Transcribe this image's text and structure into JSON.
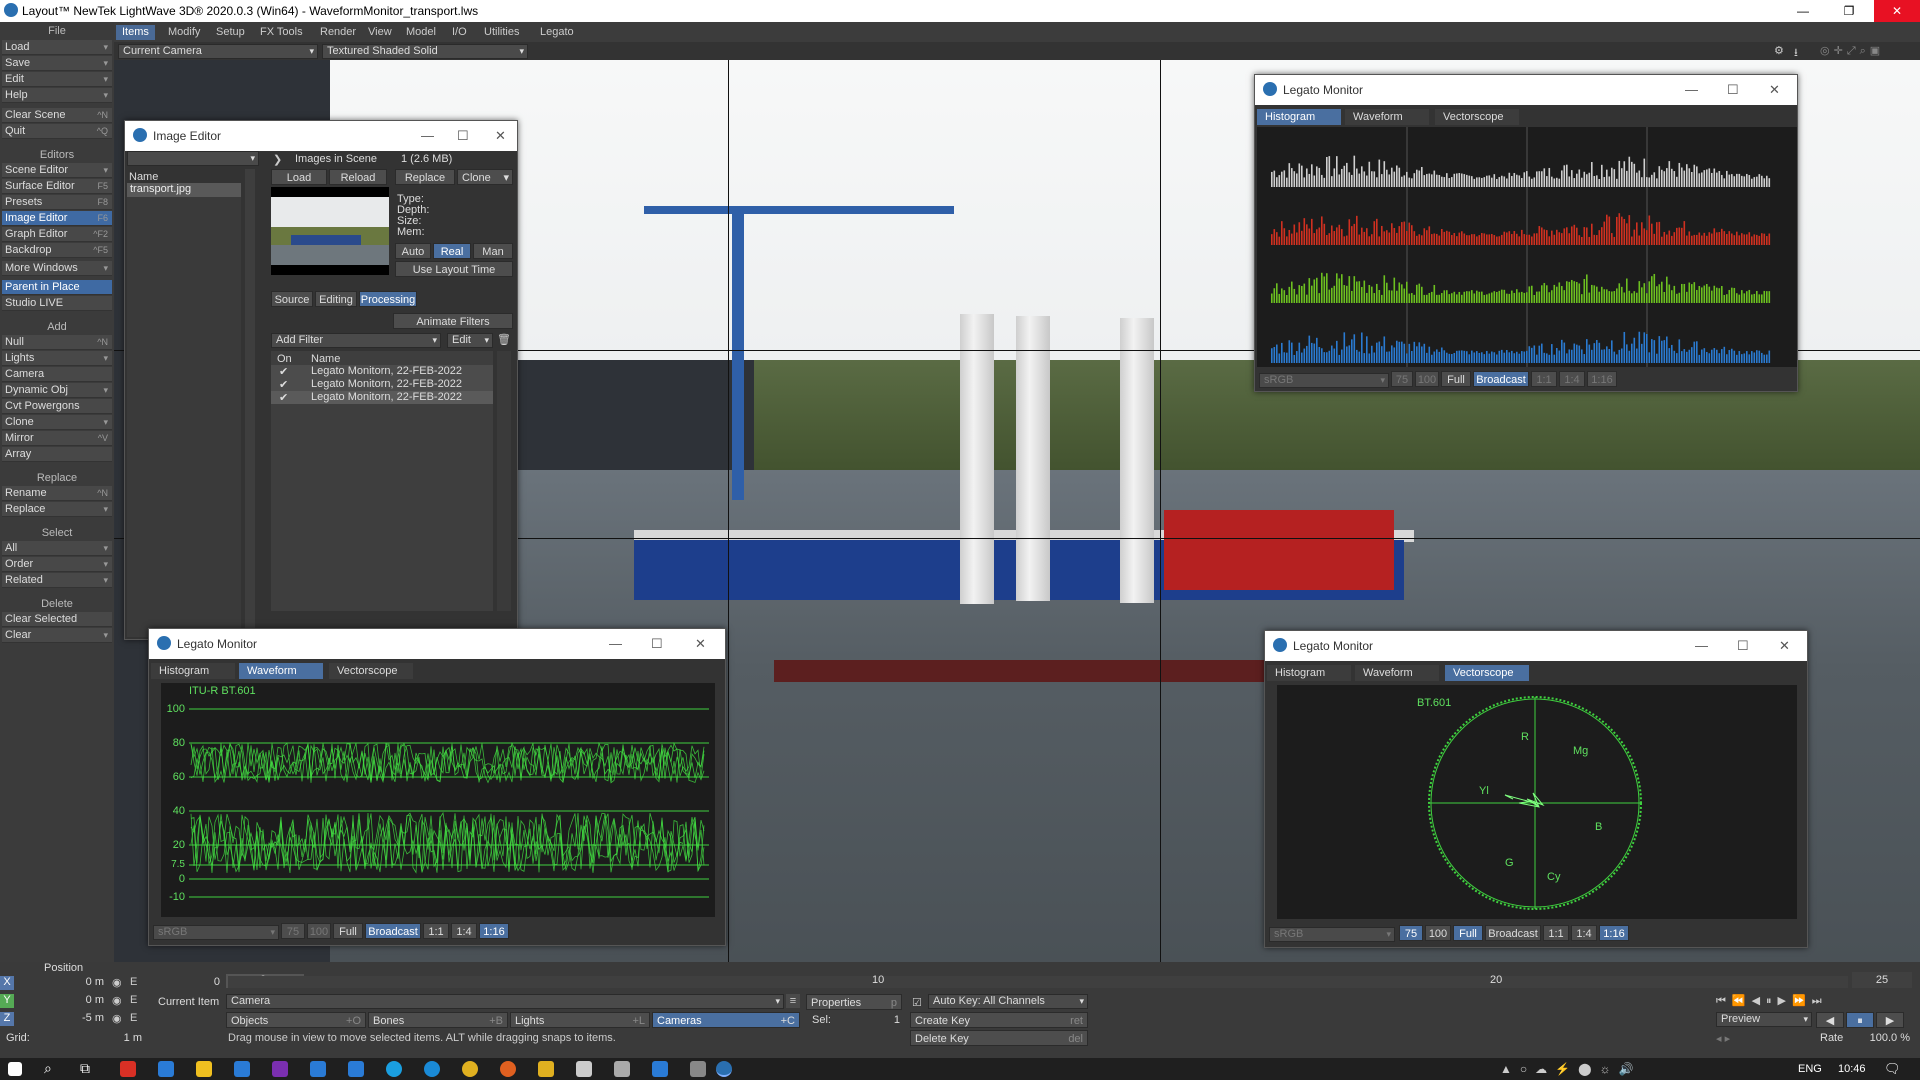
{
  "app": {
    "title": "Layout™ NewTek LightWave 3D® 2020.0.3 (Win64) - WaveformMonitor_transport.lws"
  },
  "menus": [
    "Items",
    "Modify",
    "Setup",
    "FX Tools",
    "Render",
    "View",
    "Model",
    "I/O",
    "Utilities",
    "Legato"
  ],
  "toolbar": {
    "camera": "Current Camera",
    "shading": "Textured Shaded Solid"
  },
  "sidebar": {
    "file_header": "File",
    "file": [
      {
        "label": "Load",
        "k": ""
      },
      {
        "label": "Save",
        "k": ""
      },
      {
        "label": "Edit",
        "k": ""
      },
      {
        "label": "Help",
        "k": ""
      }
    ],
    "clear_scene": {
      "label": "Clear Scene",
      "k": "^N"
    },
    "quit": {
      "label": "Quit",
      "k": "^Q"
    },
    "editors_header": "Editors",
    "editors": [
      {
        "label": "Scene Editor",
        "k": ""
      },
      {
        "label": "Surface Editor",
        "k": "F5"
      },
      {
        "label": "Presets",
        "k": "F8"
      },
      {
        "label": "Image Editor",
        "k": "F6"
      },
      {
        "label": "Graph Editor",
        "k": "^F2"
      },
      {
        "label": "Backdrop",
        "k": "^F5"
      }
    ],
    "more_windows": "More Windows",
    "parent_in_place": "Parent in Place",
    "studio_live": "Studio LIVE",
    "add_header": "Add",
    "add": [
      {
        "label": "Null",
        "k": "^N"
      },
      {
        "label": "Lights",
        "k": ""
      },
      {
        "label": "Camera",
        "k": ""
      },
      {
        "label": "Dynamic Obj",
        "k": ""
      },
      {
        "label": "Cvt Powergons",
        "k": ""
      },
      {
        "label": "Clone",
        "k": ""
      },
      {
        "label": "Mirror",
        "k": "^V"
      },
      {
        "label": "Array",
        "k": ""
      }
    ],
    "replace_header": "Replace",
    "replace": [
      {
        "label": "Rename",
        "k": "^N"
      },
      {
        "label": "Replace",
        "k": ""
      }
    ],
    "select_header": "Select",
    "select": [
      {
        "label": "All",
        "k": ""
      },
      {
        "label": "Order",
        "k": ""
      },
      {
        "label": "Related",
        "k": ""
      }
    ],
    "delete_header": "Delete",
    "delete": [
      {
        "label": "Clear Selected",
        "k": ""
      },
      {
        "label": "Clear",
        "k": ""
      }
    ]
  },
  "image_editor": {
    "title": "Image Editor",
    "name_col": "Name",
    "file": "transport.jpg",
    "images_in_scene": "Images in Scene",
    "count": "1 (2.6 MB)",
    "buttons": [
      "Load",
      "Reload",
      "Replace",
      "Clone"
    ],
    "info": [
      "Type:",
      "Depth:",
      "Size:",
      "Mem:"
    ],
    "modes": [
      "Auto",
      "Real",
      "Man"
    ],
    "use_layout_time": "Use Layout Time",
    "tabs": [
      "Source",
      "Editing",
      "Processing"
    ],
    "animate_filters": "Animate Filters",
    "add_filter": "Add Filter",
    "edit": "Edit",
    "col_on": "On",
    "col_name": "Name",
    "filters": [
      "Legato Monitorn, 22-FEB-2022",
      "Legato Monitorn, 22-FEB-2022",
      "Legato Monitorn, 22-FEB-2022"
    ]
  },
  "monitor_hist": {
    "title": "Legato Monitor",
    "tabs": [
      "Histogram",
      "Waveform",
      "Vectorscope"
    ],
    "color_space": "sRGB",
    "levels": [
      "75",
      "100"
    ],
    "range": [
      "Full",
      "Broadcast"
    ],
    "zoom": [
      "1:1",
      "1:4",
      "1:16"
    ]
  },
  "monitor_wave": {
    "title": "Legato Monitor",
    "tabs": [
      "Histogram",
      "Waveform",
      "Vectorscope"
    ],
    "standard": "ITU-R BT.601",
    "ticks": [
      "100",
      "80",
      "60",
      "40",
      "20",
      "7.5",
      "0",
      "-10"
    ],
    "color_space": "sRGB",
    "levels": [
      "75",
      "100"
    ],
    "range": [
      "Full",
      "Broadcast"
    ],
    "zoom": [
      "1:1",
      "1:4",
      "1:16"
    ]
  },
  "monitor_vec": {
    "title": "Legato Monitor",
    "tabs": [
      "Histogram",
      "Waveform",
      "Vectorscope"
    ],
    "standard": "BT.601",
    "targets": [
      "R",
      "Mg",
      "B",
      "Cy",
      "G",
      "Yl"
    ],
    "color_space": "sRGB",
    "levels": [
      "75",
      "100"
    ],
    "range": [
      "Full",
      "Broadcast"
    ],
    "zoom": [
      "1:1",
      "1:4",
      "1:16"
    ]
  },
  "position": {
    "label": "Position",
    "x": "0 m",
    "y": "0 m",
    "z": "-5 m",
    "grid_label": "Grid:",
    "grid": "1 m"
  },
  "timeline": {
    "start": "0",
    "current": "0",
    "ticks": [
      "10",
      "20"
    ],
    "end": "25"
  },
  "status": {
    "current_item": "Current Item",
    "camera": "Camera",
    "properties": "Properties",
    "properties_key": "p",
    "auto_key": "Auto Key: All Channels",
    "objects": "Objects",
    "objects_key": "+O",
    "bones": "Bones",
    "bones_key": "+B",
    "lights": "Lights",
    "lights_key": "+L",
    "cameras": "Cameras",
    "cameras_key": "+C",
    "sel_label": "Sel:",
    "sel": "1",
    "create_key": "Create Key",
    "create_key_k": "ret",
    "delete_key": "Delete Key",
    "delete_key_k": "del",
    "hint": "Drag mouse in view to move selected items. ALT while dragging snaps to items.",
    "preview": "Preview",
    "rate_label": "Rate",
    "rate": "100.0 %"
  },
  "tray": {
    "lang": "ENG",
    "time": "10:46"
  }
}
